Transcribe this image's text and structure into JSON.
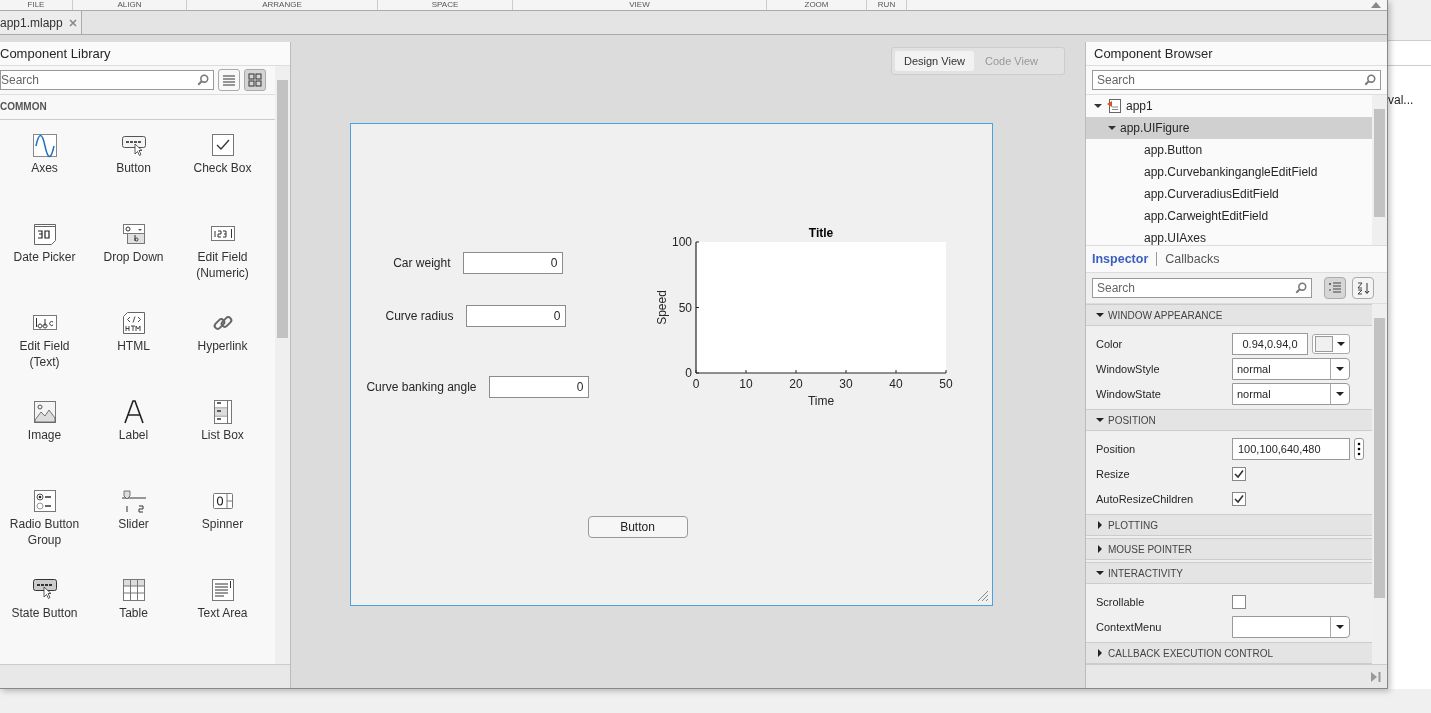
{
  "toolstrip": {
    "sections": [
      "FILE",
      "ALIGN",
      "ARRANGE",
      "SPACE",
      "VIEW",
      "ZOOM",
      "RUN"
    ]
  },
  "document_tabs": [
    {
      "label": "app1.mlapp",
      "selected": true
    }
  ],
  "component_library": {
    "title": "Component Library",
    "search": {
      "placeholder": "Search"
    },
    "view_buttons": [
      {
        "kind": "list",
        "selected": false
      },
      {
        "kind": "grid",
        "selected": true
      }
    ],
    "category": "COMMON",
    "items": [
      {
        "kind": "axes",
        "label": "Axes"
      },
      {
        "kind": "button",
        "label": "Button"
      },
      {
        "kind": "checkbox",
        "label": "Check Box"
      },
      {
        "kind": "datepicker",
        "label": "Date Picker"
      },
      {
        "kind": "dropdown",
        "label": "Drop Down"
      },
      {
        "kind": "numeric",
        "label": "Edit Field (Numeric)"
      },
      {
        "kind": "text",
        "label": "Edit Field (Text)"
      },
      {
        "kind": "html",
        "label": "HTML"
      },
      {
        "kind": "hyperlink",
        "label": "Hyperlink"
      },
      {
        "kind": "image",
        "label": "Image"
      },
      {
        "kind": "label",
        "label": "Label"
      },
      {
        "kind": "listbox",
        "label": "List Box"
      },
      {
        "kind": "radio",
        "label": "Radio Button Group"
      },
      {
        "kind": "slider",
        "label": "Slider"
      },
      {
        "kind": "spinner",
        "label": "Spinner"
      },
      {
        "kind": "statebutton",
        "label": "State Button"
      },
      {
        "kind": "table",
        "label": "Table"
      },
      {
        "kind": "textarea",
        "label": "Text Area"
      }
    ]
  },
  "view_toggle": [
    {
      "label": "Design View",
      "selected": true
    },
    {
      "label": "Code View",
      "selected": false
    }
  ],
  "canvas": {
    "fields": [
      {
        "label": "Car weight",
        "value": "0"
      },
      {
        "label": "Curve radius",
        "value": "0"
      },
      {
        "label": "Curve banking angle",
        "value": "0"
      }
    ],
    "axes": {
      "chart_data": {
        "type": "line",
        "title": "Title",
        "xlabel": "Time",
        "ylabel": "Speed",
        "xlim": [
          0,
          50
        ],
        "ylim": [
          0,
          100
        ],
        "xticks": [
          0,
          10,
          20,
          30,
          40,
          50
        ],
        "yticks": [
          0,
          50,
          100
        ]
      }
    },
    "button": "Button"
  },
  "component_browser": {
    "title": "Component Browser",
    "search": {
      "placeholder": "Search"
    },
    "tree": [
      {
        "label": "app1",
        "expanded": true,
        "selected": false,
        "children": [
          {
            "label": "app.UIFigure",
            "expanded": true,
            "selected": true,
            "children": [
              {
                "label": "app.Button",
                "selected": false
              },
              {
                "label": "app.CurvebankingangleEditField",
                "selected": false
              },
              {
                "label": "app.CurveradiusEditField",
                "selected": false
              },
              {
                "label": "app.CarweightEditField",
                "selected": false
              },
              {
                "label": "app.UIAxes",
                "selected": false
              }
            ]
          }
        ]
      }
    ]
  },
  "inspector": {
    "tabs": [
      {
        "label": "Inspector",
        "selected": true
      },
      {
        "label": "Callbacks",
        "selected": false
      }
    ],
    "search": {
      "placeholder": "Search"
    },
    "sections": [
      {
        "title": "WINDOW APPEARANCE",
        "expanded": true,
        "properties": [
          {
            "kind": "color",
            "label": "Color",
            "value": "0.94,0.94,0"
          },
          {
            "kind": "dropdown",
            "label": "WindowStyle",
            "value": "normal"
          },
          {
            "kind": "dropdown",
            "label": "WindowState",
            "value": "normal"
          }
        ]
      },
      {
        "title": "POSITION",
        "expanded": true,
        "properties": [
          {
            "kind": "vector",
            "label": "Position",
            "value": "100,100,640,480"
          },
          {
            "kind": "checkbox",
            "label": "Resize",
            "checked": true
          },
          {
            "kind": "checkbox",
            "label": "AutoResizeChildren",
            "checked": true
          }
        ]
      },
      {
        "title": "PLOTTING",
        "expanded": false
      },
      {
        "title": "MOUSE POINTER",
        "expanded": false
      },
      {
        "title": "INTERACTIVITY",
        "expanded": true,
        "properties": [
          {
            "kind": "checkbox",
            "label": "Scrollable",
            "checked": false
          },
          {
            "kind": "dropdown",
            "label": "ContextMenu"
          }
        ]
      },
      {
        "title": "CALLBACK EXECUTION CONTROL",
        "expanded": false
      }
    ]
  },
  "background_window": {
    "text": "val..."
  }
}
